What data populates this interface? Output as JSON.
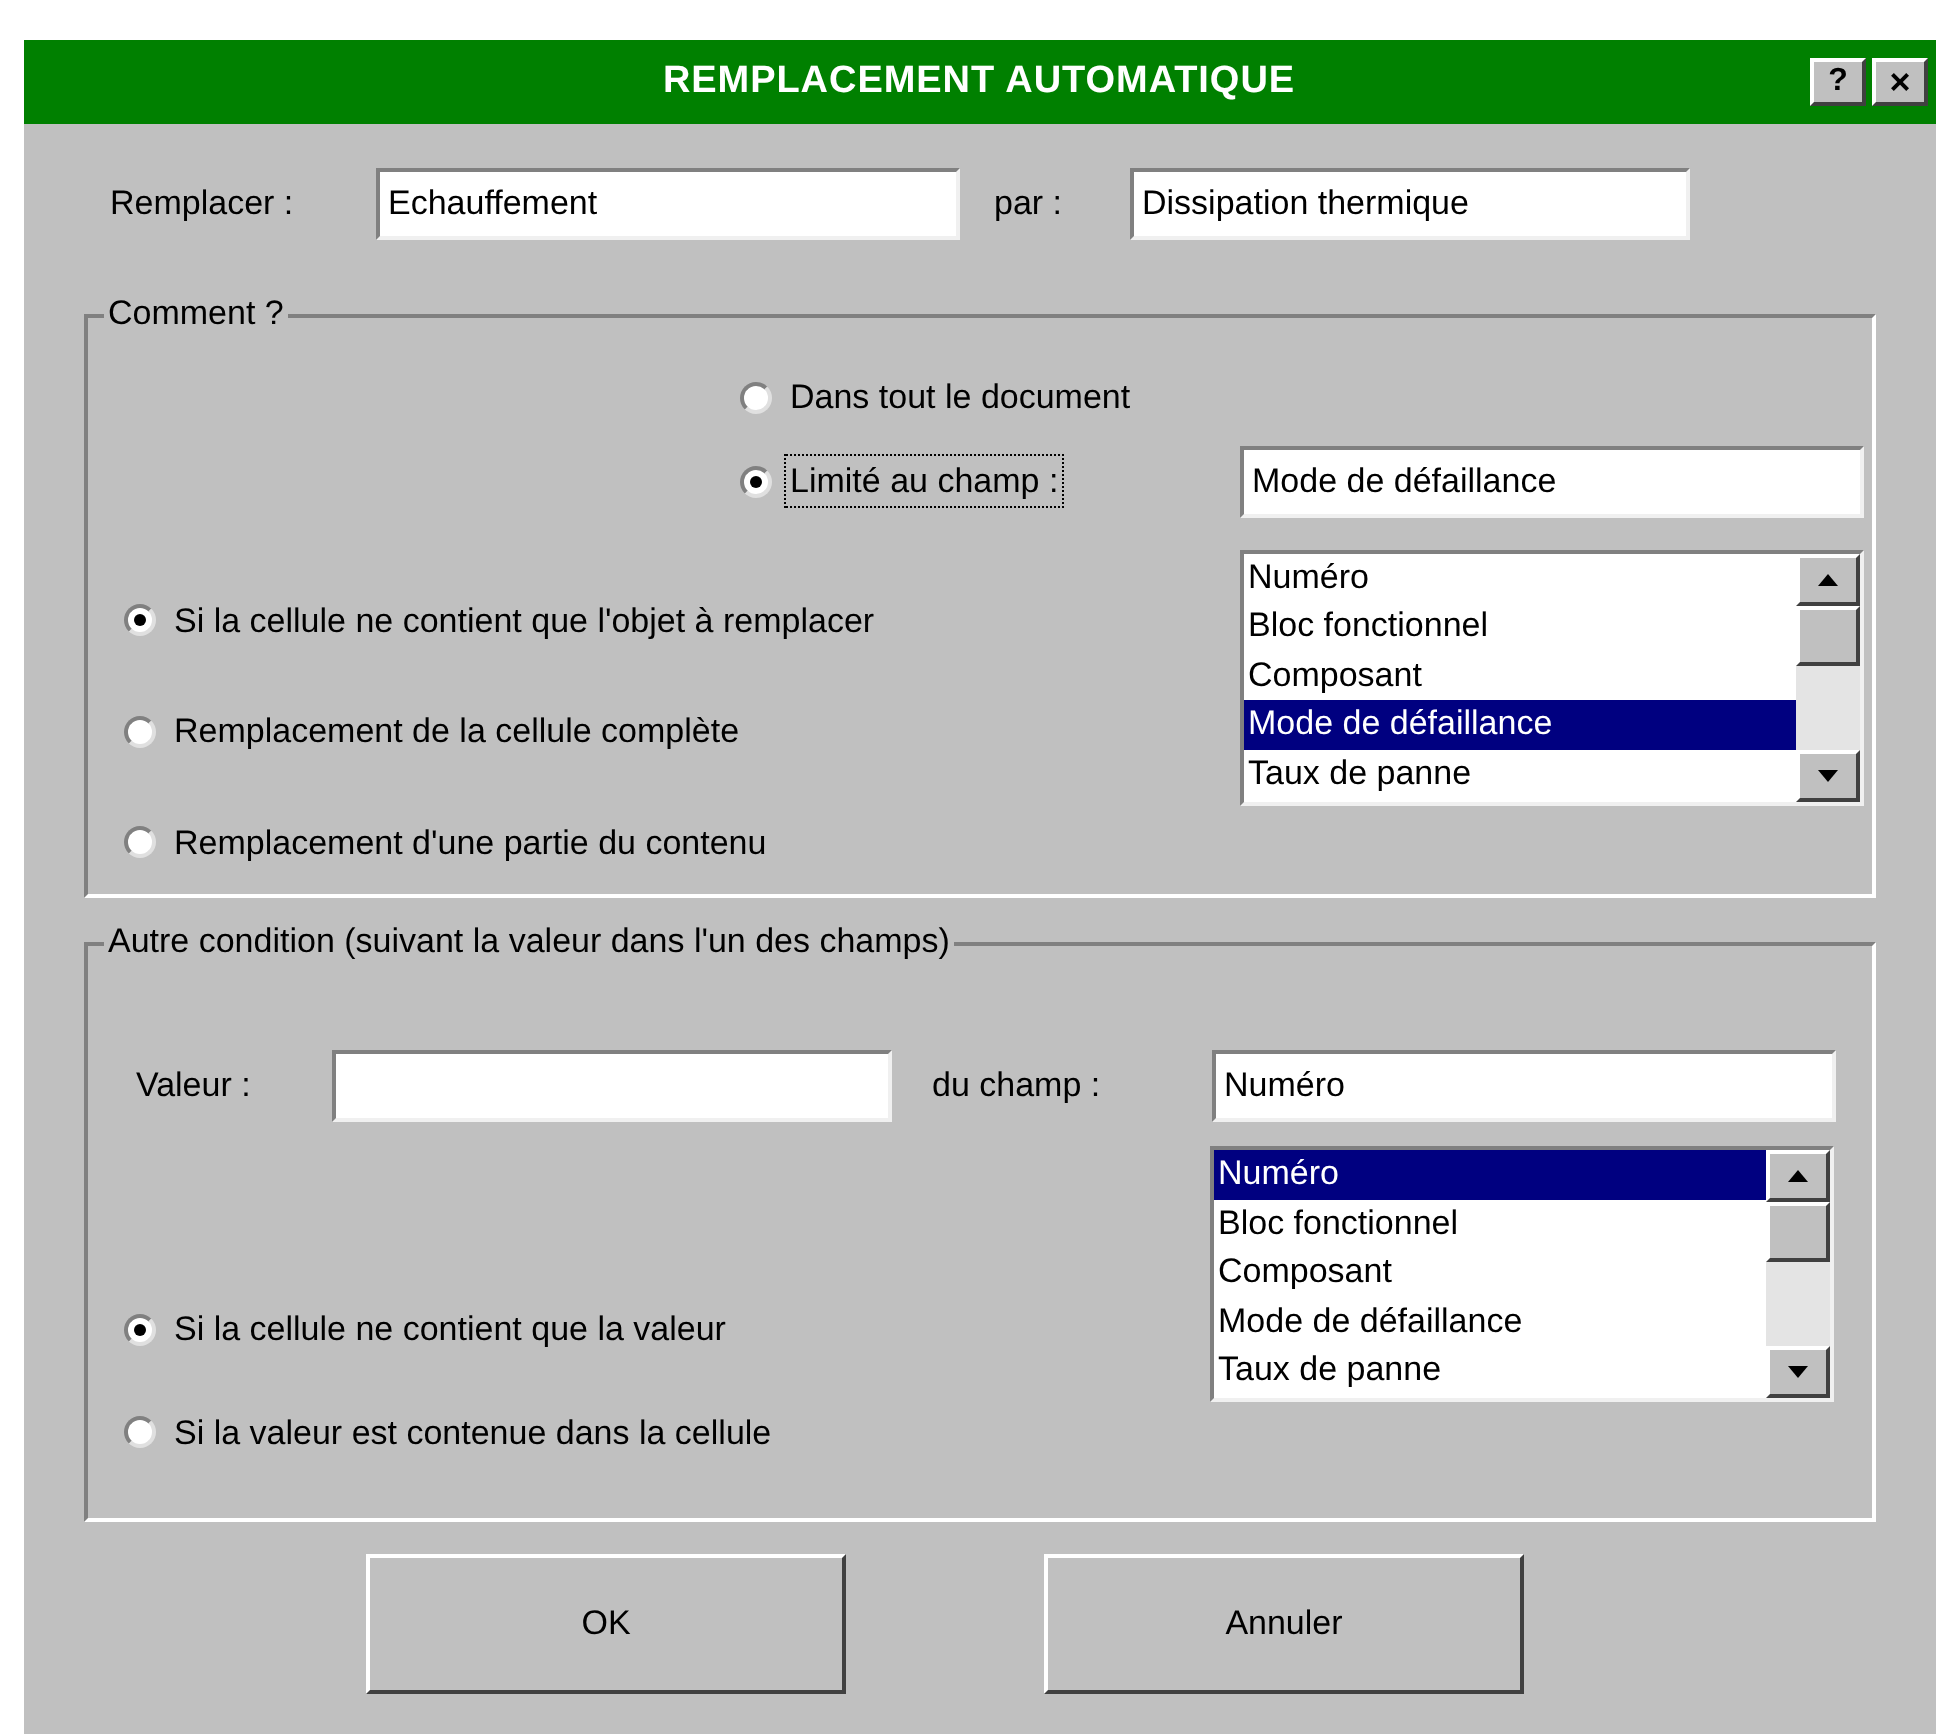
{
  "window": {
    "title": "REMPLACEMENT AUTOMATIQUE",
    "help": "?",
    "close": "×"
  },
  "replace": {
    "label": "Remplacer :",
    "value": "Echauffement",
    "by_label": "par :",
    "by_value": "Dissipation thermique"
  },
  "how": {
    "legend": "Comment ?",
    "scope": [
      {
        "label": "Dans tout le document",
        "selected": false,
        "focused": false
      },
      {
        "label": "Limité au champ :",
        "selected": true,
        "focused": true
      }
    ],
    "field_value": "Mode de défaillance",
    "mode": [
      {
        "label": "Si la cellule ne contient que l'objet à remplacer",
        "selected": true
      },
      {
        "label": "Remplacement de la cellule complète",
        "selected": false
      },
      {
        "label": "Remplacement d'une partie du contenu",
        "selected": false
      }
    ],
    "fields": [
      {
        "label": "Numéro",
        "selected": false
      },
      {
        "label": "Bloc fonctionnel",
        "selected": false
      },
      {
        "label": "Composant",
        "selected": false
      },
      {
        "label": "Mode de défaillance",
        "selected": true
      },
      {
        "label": "Taux de panne",
        "selected": false
      }
    ]
  },
  "condition": {
    "legend": "Autre condition (suivant la valeur dans l'un des champs)",
    "value_label": "Valeur :",
    "field_label": "du champ :",
    "field_value": "Numéro",
    "fields": [
      {
        "label": "Numéro",
        "selected": true
      },
      {
        "label": "Bloc fonctionnel",
        "selected": false
      },
      {
        "label": "Composant",
        "selected": false
      },
      {
        "label": "Mode de défaillance",
        "selected": false
      },
      {
        "label": "Taux de panne",
        "selected": false
      }
    ],
    "mode": [
      {
        "label": "Si la cellule ne contient que la valeur",
        "selected": true
      },
      {
        "label": "Si la valeur est contenue dans la cellule",
        "selected": false
      }
    ]
  },
  "buttons": [
    "OK",
    "Annuler"
  ]
}
